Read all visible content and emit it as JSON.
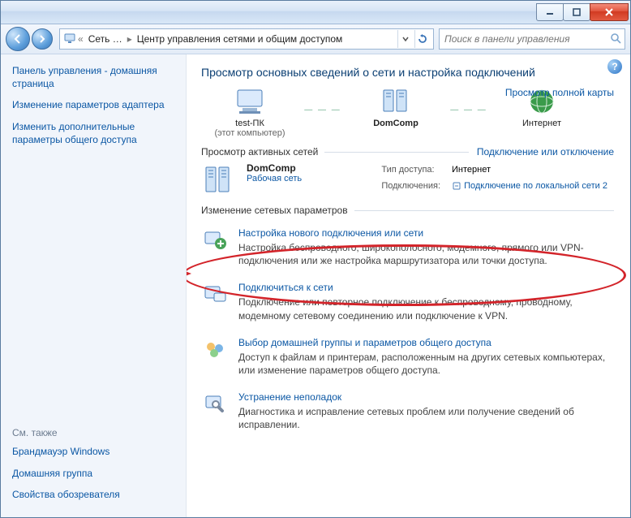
{
  "titlebar": {},
  "breadcrumb": {
    "item1": "Сеть …",
    "item2": "Центр управления сетями и общим доступом"
  },
  "search": {
    "placeholder": "Поиск в панели управления"
  },
  "sidebar": {
    "links": [
      "Панель управления - домашняя страница",
      "Изменение параметров адаптера",
      "Изменить дополнительные параметры общего доступа"
    ],
    "seealso_hdr": "См. также",
    "seealso": [
      "Брандмауэр Windows",
      "Домашняя группа",
      "Свойства обозревателя"
    ]
  },
  "main": {
    "title": "Просмотр основных сведений о сети и настройка подключений",
    "mapview": "Просмотр полной карты",
    "topology": {
      "node1": {
        "label": "test-ПК",
        "sub": "(этот компьютер)"
      },
      "node2": {
        "label": "DomComp",
        "sub": ""
      },
      "node3": {
        "label": "Интернет",
        "sub": ""
      }
    },
    "active_hdr": "Просмотр активных сетей",
    "active_link": "Подключение или отключение",
    "active": {
      "name": "DomComp",
      "type": "Рабочая сеть",
      "props": {
        "access_lbl": "Тип доступа:",
        "access_val": "Интернет",
        "conn_lbl": "Подключения:",
        "conn_val": "Подключение по локальной сети 2"
      }
    },
    "change_hdr": "Изменение сетевых параметров",
    "tasks": [
      {
        "title": "Настройка нового подключения или сети",
        "desc": "Настройка беспроводного, широкополосного, модемного, прямого или VPN-подключения или же настройка маршрутизатора или точки доступа."
      },
      {
        "title": "Подключиться к сети",
        "desc": "Подключение или повторное подключение к беспроводному, проводному, модемному сетевому соединению или подключение к VPN."
      },
      {
        "title": "Выбор домашней группы и параметров общего доступа",
        "desc": "Доступ к файлам и принтерам, расположенным на других сетевых компьютерах, или изменение параметров общего доступа."
      },
      {
        "title": "Устранение неполадок",
        "desc": "Диагностика и исправление сетевых проблем или получение сведений об исправлении."
      }
    ]
  }
}
